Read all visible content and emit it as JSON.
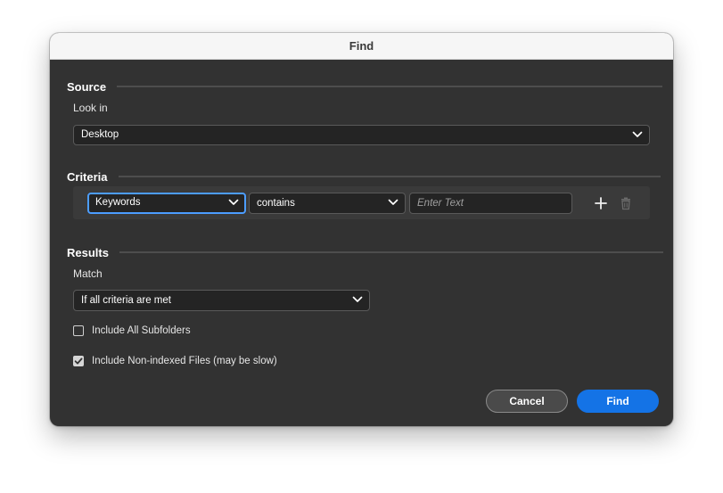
{
  "window": {
    "title": "Find"
  },
  "source": {
    "title": "Source",
    "look_in_label": "Look in",
    "look_in_value": "Desktop"
  },
  "criteria": {
    "title": "Criteria",
    "field_value": "Keywords",
    "operator_value": "contains",
    "text_placeholder": "Enter Text",
    "add_icon": "plus-icon",
    "remove_icon": "trash-icon"
  },
  "results": {
    "title": "Results",
    "match_label": "Match",
    "match_value": "If all criteria are met",
    "include_subfolders_label": "Include All Subfolders",
    "include_subfolders_checked": false,
    "include_nonindexed_label": "Include Non-indexed Files (may be slow)",
    "include_nonindexed_checked": true
  },
  "buttons": {
    "cancel_label": "Cancel",
    "find_label": "Find"
  },
  "colors": {
    "dialog_background": "#323232",
    "primary_accent": "#1473e6",
    "focus_ring": "#4c9dff"
  }
}
